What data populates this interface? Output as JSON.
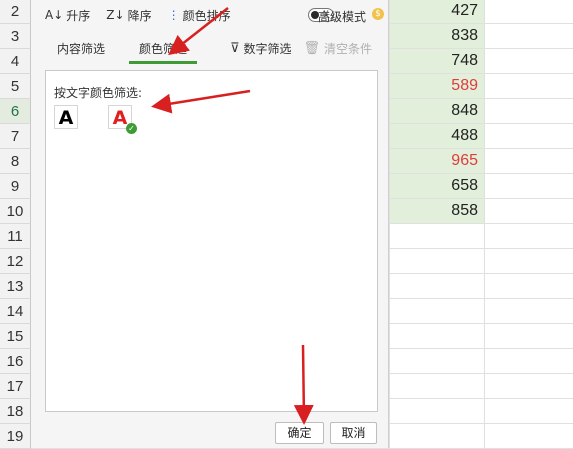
{
  "row_numbers": [
    "2",
    "3",
    "4",
    "5",
    "6",
    "7",
    "8",
    "9",
    "10",
    "11",
    "12",
    "13",
    "14",
    "15",
    "16",
    "17",
    "18",
    "19"
  ],
  "selected_row": "6",
  "values": [
    {
      "text": "427",
      "color": "normal"
    },
    {
      "text": "838",
      "color": "normal"
    },
    {
      "text": "748",
      "color": "normal"
    },
    {
      "text": "589",
      "color": "red"
    },
    {
      "text": "848",
      "color": "normal"
    },
    {
      "text": "488",
      "color": "normal"
    },
    {
      "text": "965",
      "color": "red"
    },
    {
      "text": "658",
      "color": "normal"
    },
    {
      "text": "858",
      "color": "normal"
    }
  ],
  "toolbar": {
    "sort_asc": "升序",
    "sort_desc": "降序",
    "color_sort": "颜色排序",
    "toggle_label": "关",
    "advanced_mode": "高级模式"
  },
  "tabs": {
    "content_filter": "内容筛选",
    "color_filter": "颜色筛选",
    "number_filter": "数字筛选",
    "clear_conditions": "清空条件"
  },
  "content": {
    "label": "按文字颜色筛选:",
    "swatch_black": "A",
    "swatch_red": "A"
  },
  "buttons": {
    "ok": "确定",
    "cancel": "取消"
  },
  "colors": {
    "accent_green": "#3f9b35",
    "cell_green": "#e2efda",
    "red_text": "#e03c3c",
    "arrow_red": "#d92020"
  }
}
